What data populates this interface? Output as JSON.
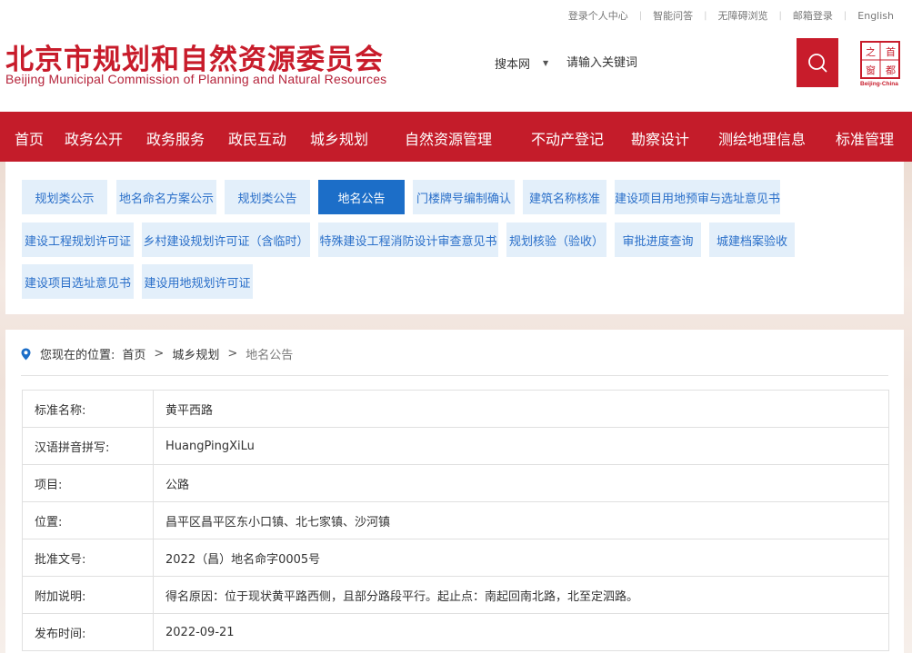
{
  "top_links": [
    "登录个人中心",
    "智能问答",
    "无障碍浏览",
    "邮箱登录",
    "English"
  ],
  "logo": {
    "cn": "北京市规划和自然资源委员会",
    "en": "Beijing Municipal Commission of Planning and Natural Resources"
  },
  "search": {
    "scope": "搜本网",
    "placeholder": "请输入关键词"
  },
  "seal": {
    "chars": [
      "首",
      "都",
      "之",
      "窗"
    ],
    "caption": "Beijing-China"
  },
  "nav": [
    "首页",
    "政务公开",
    "政务服务",
    "政民互动",
    "城乡规划",
    "自然资源管理",
    "不动产登记",
    "勘察设计",
    "测绘地理信息",
    "标准管理"
  ],
  "tabs": [
    "规划类公示",
    "地名命名方案公示",
    "规划类公告",
    "地名公告",
    "门楼牌号编制确认",
    "建筑名称核准",
    "建设项目用地预审与选址意见书",
    "建设工程规划许可证",
    "乡村建设规划许可证（含临时）",
    "特殊建设工程消防设计审查意见书",
    "规划核验（验收）",
    "审批进度查询",
    "城建档案验收",
    "建设项目选址意见书",
    "建设用地规划许可证"
  ],
  "active_tab": "地名公告",
  "breadcrumb": {
    "prefix": "您现在的位置:",
    "items": [
      "首页",
      "城乡规划",
      "地名公告"
    ]
  },
  "details": [
    {
      "label": "标准名称:",
      "value": "黄平西路"
    },
    {
      "label": "汉语拼音拼写:",
      "value": "HuangPingXiLu"
    },
    {
      "label": "项目:",
      "value": "公路"
    },
    {
      "label": "位置:",
      "value": "昌平区昌平区东小口镇、北七家镇、沙河镇"
    },
    {
      "label": "批准文号:",
      "value": "2022（昌）地名命字0005号"
    },
    {
      "label": "附加说明:",
      "value": "得名原因：位于现状黄平路西侧，且部分路段平行。起止点：南起回南北路，北至定泗路。"
    },
    {
      "label": "发布时间:",
      "value": "2022-09-21"
    }
  ],
  "colors": {
    "brand_red": "#c41c2a",
    "tab_bg": "#e3effa",
    "tab_text": "#2a6fc9",
    "tab_active": "#1c6ec8"
  }
}
